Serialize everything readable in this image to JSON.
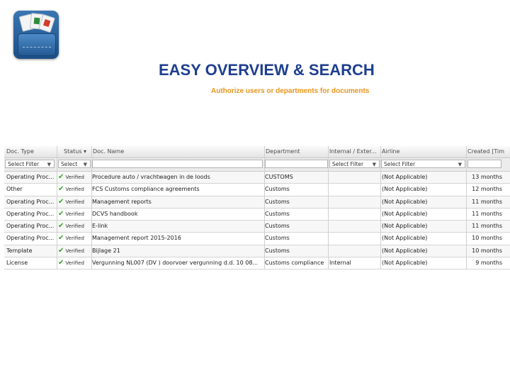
{
  "header": {
    "title": "EASY OVERVIEW & SEARCH",
    "subtitle": "Authorize users or departments for documents"
  },
  "grid": {
    "columns": [
      "Doc. Type",
      "Status",
      "Doc. Name",
      "Department",
      "Internal / Exter...",
      "Airline",
      "Created [Tim"
    ],
    "filters": {
      "doc_type": "Select Filter",
      "status": "Select",
      "internal": "Select Filter",
      "airline": "Select Filter"
    },
    "rows": [
      {
        "type": "Operating Proc...",
        "status": "Verified",
        "name": "Procedure auto / vrachtwagen in de loods",
        "dept": "CUSTOMS",
        "internal": "",
        "airline": "(Not Applicable)",
        "created": "13 months"
      },
      {
        "type": "Other",
        "status": "Verified",
        "name": "FCS Customs compliance agreements",
        "dept": "Customs",
        "internal": "",
        "airline": "(Not Applicable)",
        "created": "12 months"
      },
      {
        "type": "Operating Proc...",
        "status": "Verified",
        "name": "Management reports",
        "dept": "Customs",
        "internal": "",
        "airline": "(Not Applicable)",
        "created": "11 months"
      },
      {
        "type": "Operating Proc...",
        "status": "Verified",
        "name": "DCVS handbook",
        "dept": "Customs",
        "internal": "",
        "airline": "(Not Applicable)",
        "created": "11 months"
      },
      {
        "type": "Operating Proc...",
        "status": "Verified",
        "name": "E-link",
        "dept": "Customs",
        "internal": "",
        "airline": "(Not Applicable)",
        "created": "11 months"
      },
      {
        "type": "Operating Proc...",
        "status": "Verified",
        "name": "Management report 2015-2016",
        "dept": "Customs",
        "internal": "",
        "airline": "(Not Applicable)",
        "created": "10 months"
      },
      {
        "type": "Template",
        "status": "Verified",
        "name": "Bijlage 21",
        "dept": "Customs",
        "internal": "",
        "airline": "(Not Applicable)",
        "created": "10 months"
      },
      {
        "type": "License",
        "status": "Verified",
        "name": "Vergunning NL007 (DV ) doorvoer vergunning d.d. 10 08...",
        "dept": "Customs compliance",
        "internal": "Internal",
        "airline": "(Not Applicable)",
        "created": "9 months"
      }
    ]
  },
  "colors": {
    "title": "#1e3f8f",
    "subtitle": "#e8951e",
    "verified_check": "#3aa32c"
  }
}
